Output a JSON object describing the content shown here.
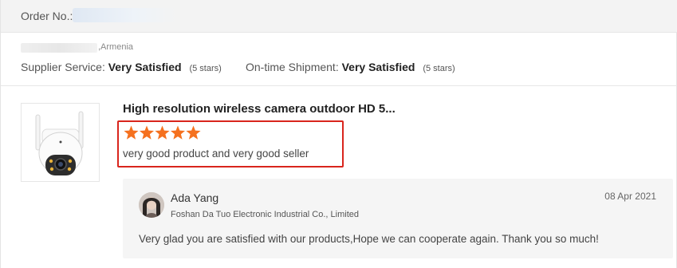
{
  "order": {
    "label": "Order No.:"
  },
  "buyer": {
    "country": ",Armenia"
  },
  "ratings": [
    {
      "label": "Supplier Service:",
      "value": "Very Satisfied",
      "note": "(5 stars)"
    },
    {
      "label": "On-time Shipment:",
      "value": "Very Satisfied",
      "note": "(5 stars)"
    }
  ],
  "review": {
    "product_title": "High resolution wireless camera outdoor HD 5...",
    "stars": 5,
    "star_color": "#f5711f",
    "text": "very good product and very good seller",
    "highlight_color": "#d9251d",
    "product_image": "security-camera-image"
  },
  "reply": {
    "name": "Ada Yang",
    "company": "Foshan Da Tuo Electronic Industrial Co., Limited",
    "date": "08 Apr 2021",
    "text": "Very glad you are satisfied with our products,Hope we can cooperate again. Thank you so much!",
    "avatar": "seller-avatar"
  }
}
